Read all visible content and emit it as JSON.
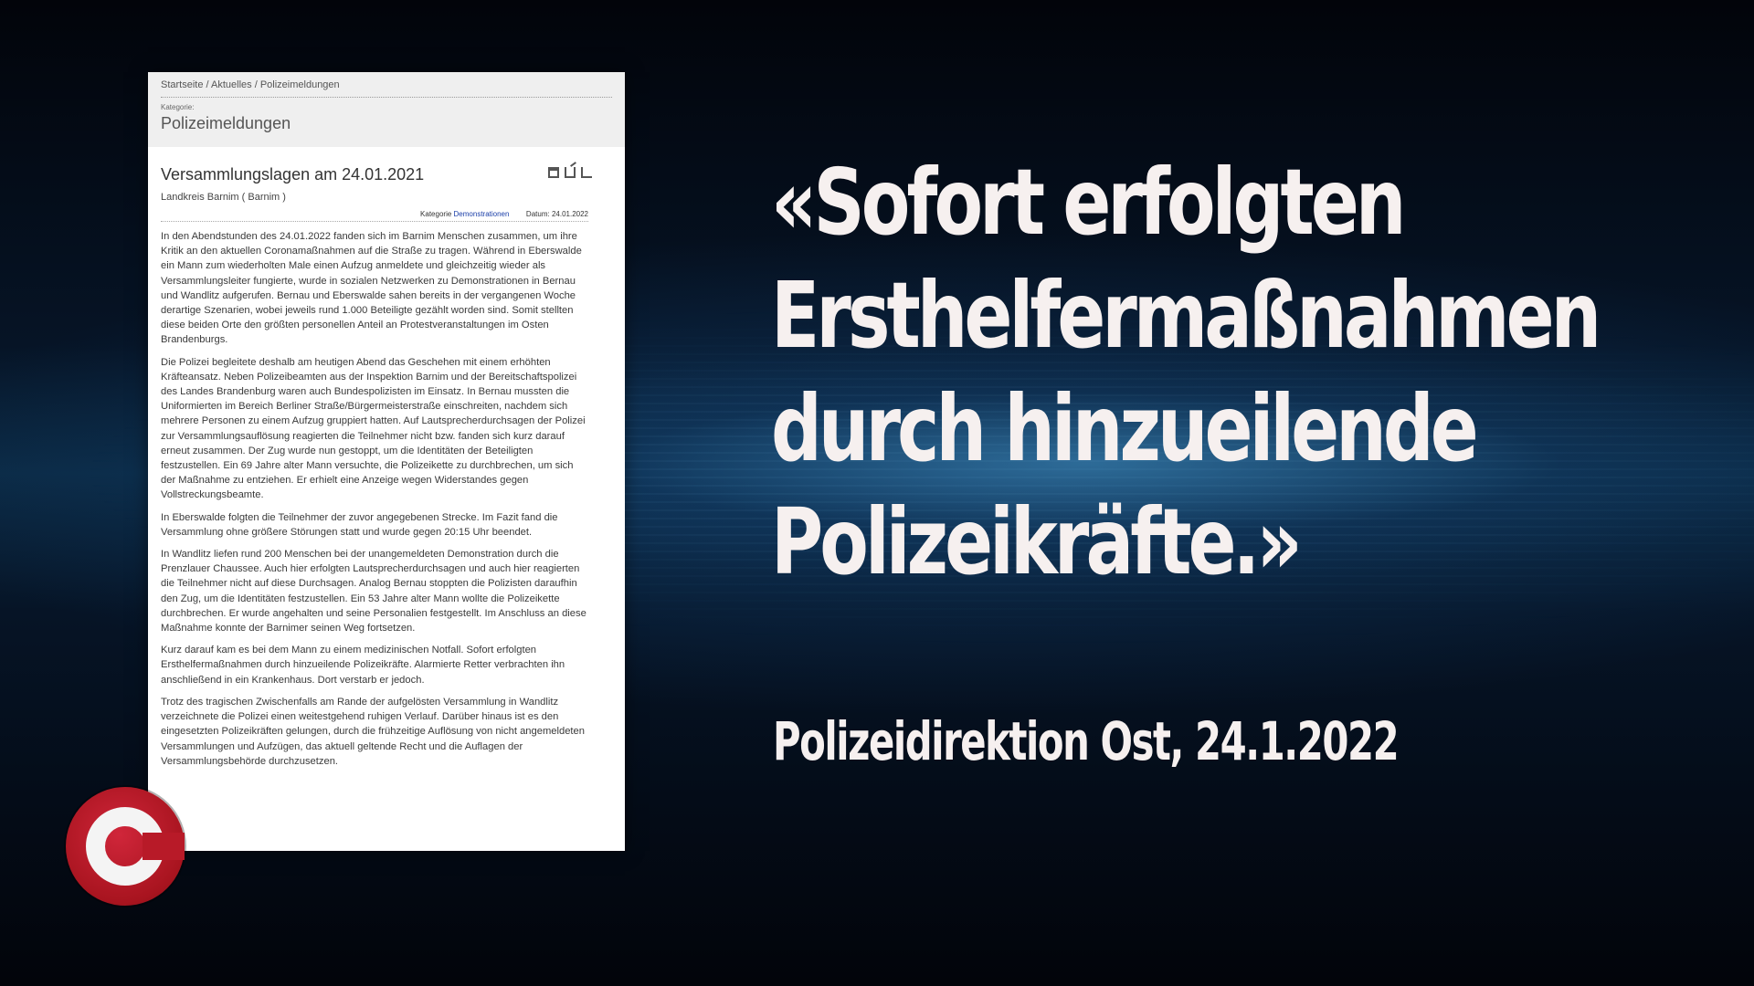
{
  "document": {
    "breadcrumb": "Startseite / Aktuelles / Polizeimeldungen",
    "category_label": "Kategorie:",
    "category_title": "Polizeimeldungen",
    "article_title": "Versammlungslagen am 24.01.2021",
    "district": "Landkreis Barnim ( Barnim )",
    "meta_category_label": "Kategorie",
    "meta_category_value": "Demonstrationen",
    "meta_date_label": "Datum:",
    "meta_date_value": "24.01.2022",
    "paragraphs": [
      "In den Abendstunden des 24.01.2022 fanden sich im Barnim Menschen zusammen, um ihre Kritik an den aktuellen Coronamaßnahmen auf die Straße zu tragen. Während in Eberswalde ein Mann zum wiederholten Male einen Aufzug anmeldete und gleichzeitig wieder als Versammlungsleiter fungierte, wurde in sozialen Netzwerken zu Demonstrationen in Bernau und Wandlitz aufgerufen. Bernau und Eberswalde sahen bereits in der vergangenen Woche derartige Szenarien, wobei jeweils rund 1.000 Beteiligte gezählt worden sind. Somit stellten diese beiden Orte den größten personellen Anteil an Protestveranstaltungen im Osten Brandenburgs.",
      "Die Polizei begleitete deshalb am heutigen Abend das Geschehen mit einem erhöhten Kräfteansatz. Neben Polizeibeamten aus der Inspektion Barnim und der Bereitschaftspolizei des Landes Brandenburg waren auch Bundespolizisten im Einsatz. In Bernau mussten die Uniformierten im Bereich Berliner Straße/Bürgermeisterstraße einschreiten, nachdem sich mehrere Personen zu einem Aufzug gruppiert hatten. Auf Lautsprecherdurchsagen der Polizei zur Versammlungsauflösung reagierten die Teilnehmer nicht bzw. fanden sich kurz darauf erneut zusammen. Der Zug wurde nun gestoppt, um die Identitäten der Beteiligten festzustellen. Ein 69 Jahre alter Mann versuchte, die Polizeikette zu durchbrechen, um sich der Maßnahme zu entziehen. Er erhielt eine Anzeige wegen Widerstandes gegen Vollstreckungsbeamte.",
      "In Eberswalde folgten die Teilnehmer der zuvor angegebenen Strecke. Im Fazit fand die Versammlung ohne größere Störungen statt und wurde gegen 20:15 Uhr beendet.",
      "In Wandlitz liefen rund 200 Menschen bei der unangemeldeten Demonstration durch die Prenzlauer Chaussee. Auch hier erfolgten Lautsprecherdurchsagen und auch hier reagierten die Teilnehmer nicht auf diese Durchsagen. Analog Bernau stoppten die Polizisten daraufhin den Zug, um die Identitäten festzustellen. Ein 53 Jahre alter Mann wollte die Polizeikette durchbrechen. Er wurde angehalten und seine Personalien festgestellt. Im Anschluss an diese Maßnahme konnte der Barnimer seinen Weg fortsetzen.",
      "Kurz darauf kam es bei dem Mann zu einem medizinischen Notfall. Sofort erfolgten Ersthelfermaßnahmen durch hinzueilende Polizeikräfte. Alarmierte Retter verbrachten ihn anschließend in ein Krankenhaus. Dort verstarb er jedoch.",
      "Trotz des tragischen Zwischenfalls am Rande der aufgelösten Versammlung in Wandlitz verzeichnete die Polizei einen weitestgehend ruhigen Verlauf. Darüber hinaus ist es den eingesetzten Polizeikräften gelungen, durch die frühzeitige Auflösung von nicht angemeldeten Versammlungen und Aufzügen, das aktuell geltende Recht und die Auflagen der Versammlungsbehörde durchzusetzen."
    ]
  },
  "quote": {
    "lines": [
      "«Sofort erfolgten",
      "Ersthelfermaßnahmen",
      "durch hinzueilende",
      "Polizeikräfte.»"
    ],
    "source": "Polizeidirektion Ost, 24.1.2022"
  },
  "logo": {
    "icon": "c-logo-icon",
    "color": "#b81a28"
  }
}
